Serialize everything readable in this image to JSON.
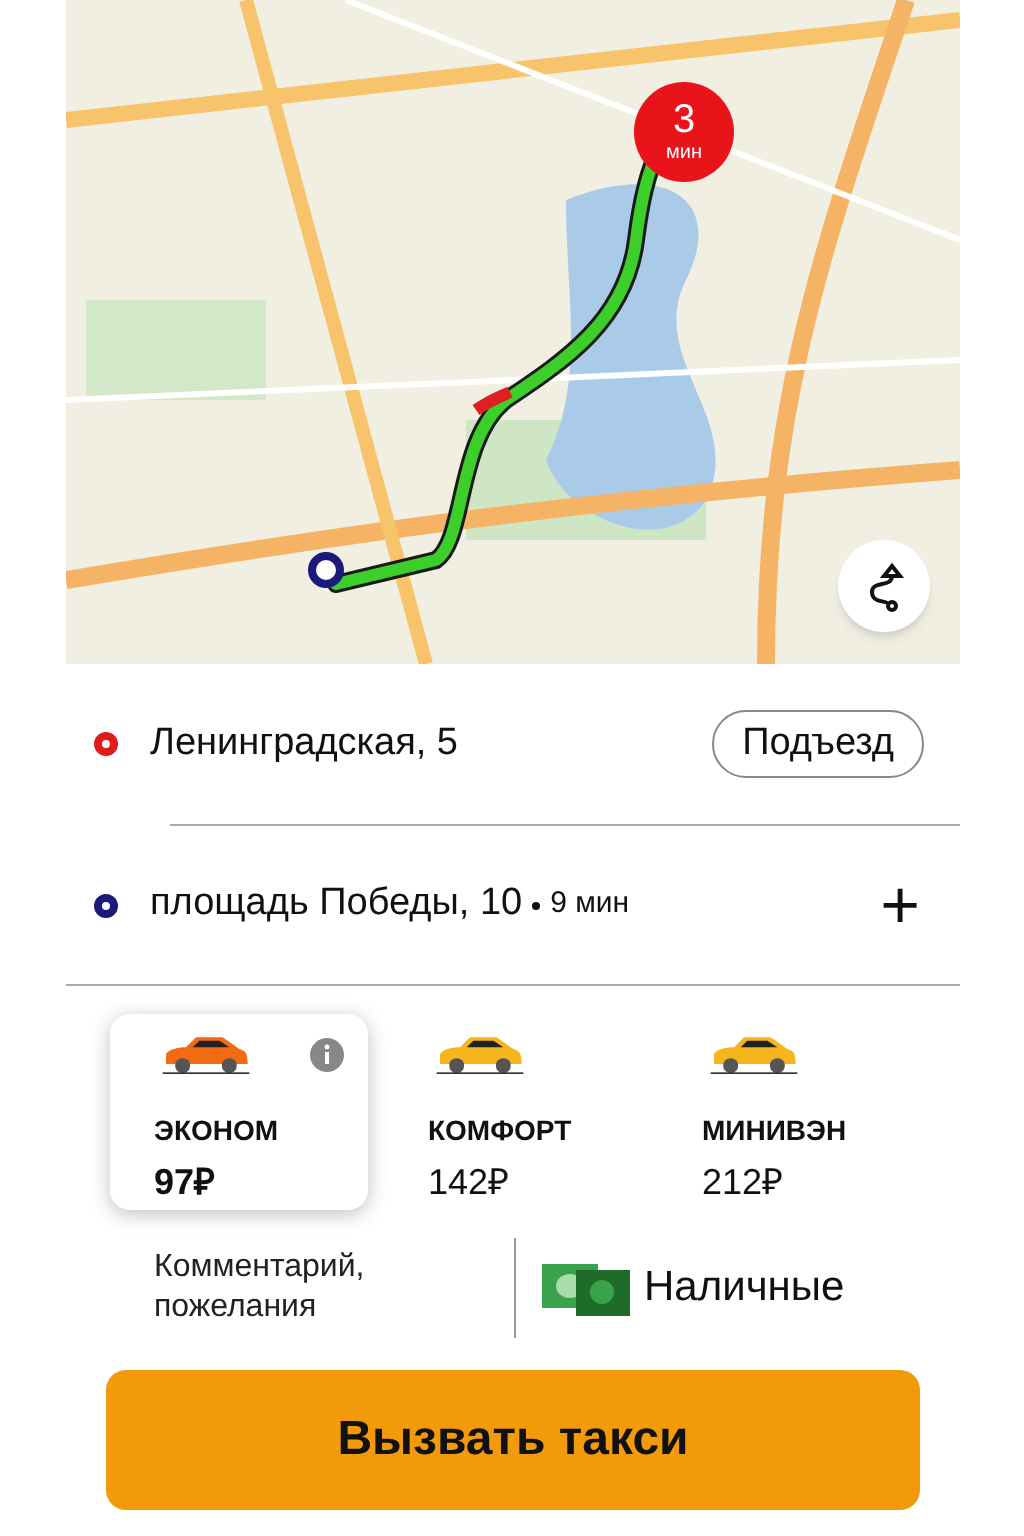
{
  "map": {
    "kind": "picture",
    "eta_badge": {
      "value": "3",
      "unit": "мин"
    }
  },
  "route": [
    {
      "kind": "origin",
      "color": "#e01b1b",
      "address": "Ленинградская, 5",
      "action": "Подъезд"
    },
    {
      "kind": "destination",
      "color": "#1a1a7a",
      "address": "площадь Победы, 10",
      "duration": "9 мин",
      "action": "+"
    }
  ],
  "tariffs": [
    {
      "name": "ЭКОНОМ",
      "price": "97₽",
      "selected": true
    },
    {
      "name": "КОМФОРТ",
      "price": "142₽",
      "selected": false
    },
    {
      "name": "МИНИВЭН",
      "price": "212₽",
      "selected": false
    }
  ],
  "comment": "Комментарий, пожелания",
  "payment": "Наличные",
  "order_button": "Вызвать такси"
}
